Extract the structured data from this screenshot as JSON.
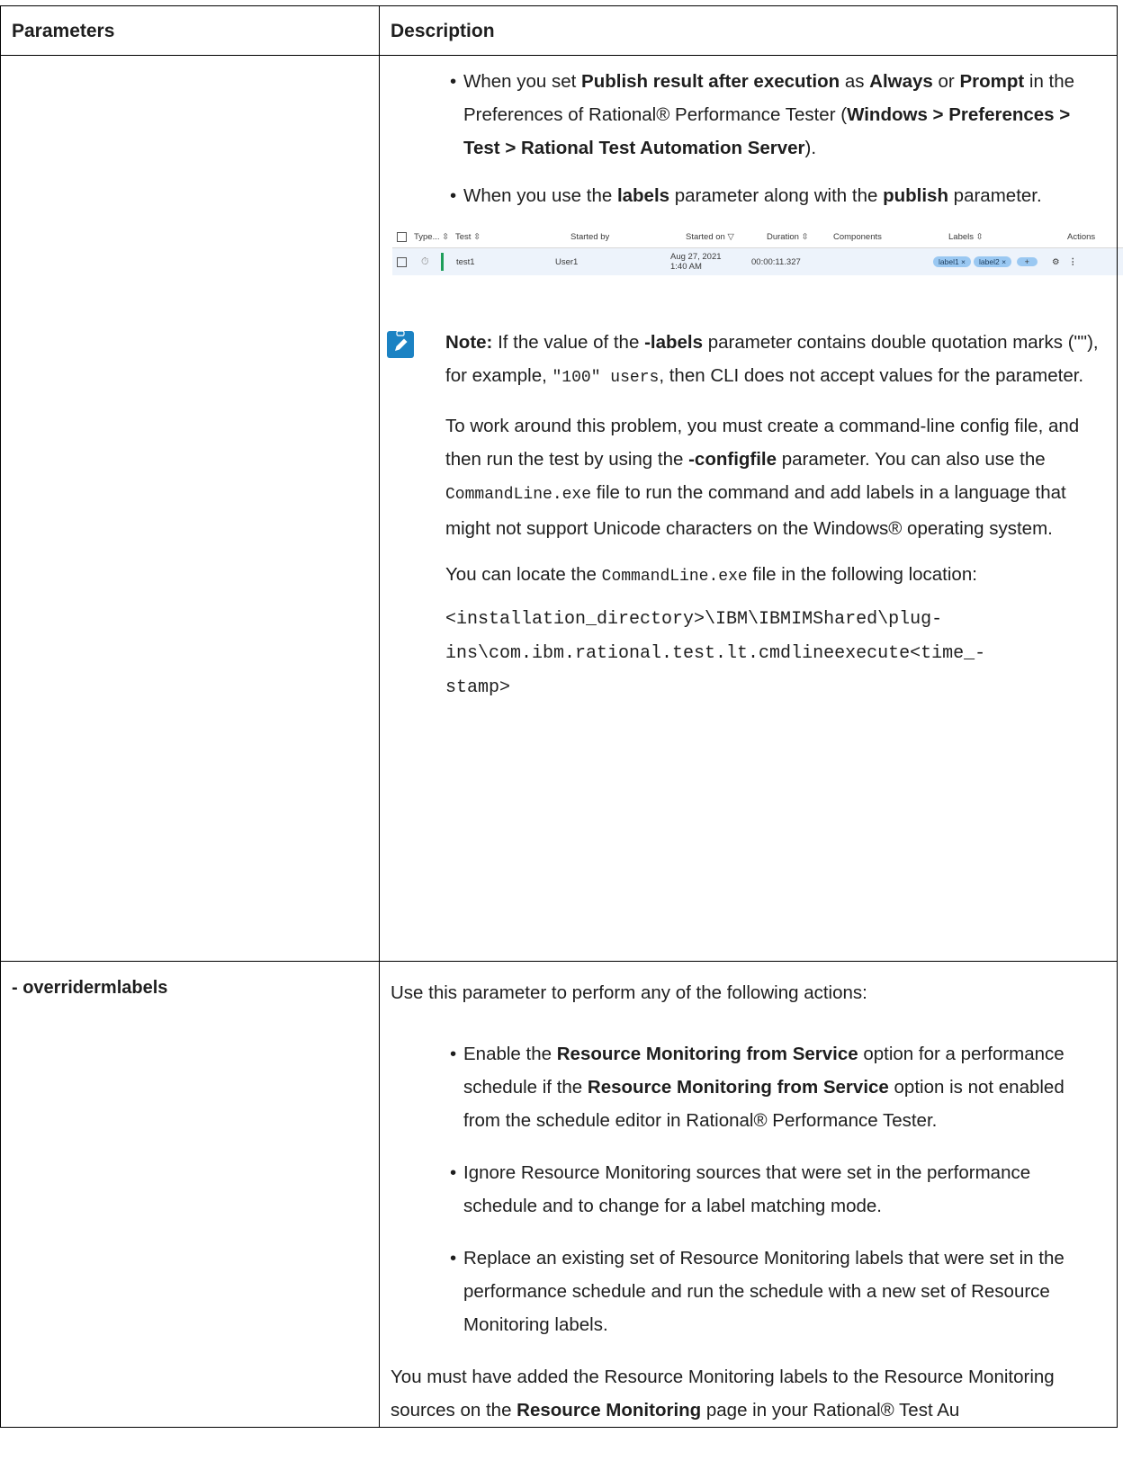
{
  "table": {
    "header": {
      "col1": "Parameters",
      "col2": "Description"
    }
  },
  "row1": {
    "bullets": [
      {
        "parts": [
          {
            "t": "When you set ",
            "b": false
          },
          {
            "t": "Publish result after execution",
            "b": true
          },
          {
            "t": " as ",
            "b": false
          },
          {
            "t": "Always",
            "b": true
          },
          {
            "t": " or ",
            "b": false
          },
          {
            "t": "Prompt",
            "b": true
          },
          {
            "t": " in the Preferences of  Rational® Performance Tester (",
            "b": false
          },
          {
            "t": "Windows > Preferences > Test > Rational Test Automation Server",
            "b": true
          },
          {
            "t": ").",
            "b": false
          }
        ]
      },
      {
        "parts": [
          {
            "t": "When you use the ",
            "b": false
          },
          {
            "t": "labels",
            "b": true
          },
          {
            "t": " parameter along with the ",
            "b": false
          },
          {
            "t": "publish",
            "b": true
          },
          {
            "t": " parameter.",
            "b": false
          }
        ]
      }
    ],
    "screenshot": {
      "headers": [
        "Type...",
        "Test",
        "Started by",
        "Started on",
        "Duration",
        "Components",
        "Labels",
        "Actions"
      ],
      "row": {
        "test": "test1",
        "started_by": "User1",
        "started_on_date": "Aug 27, 2021",
        "started_on_time": "1:40 AM",
        "duration": "00:00:11.327",
        "labels": [
          "label1",
          "label2"
        ],
        "add": "+"
      },
      "colors": {
        "row_bg": "#edf3fb",
        "status_bar": "#1e9e5a",
        "pill": "#9ac8f2"
      }
    },
    "note": {
      "icon": "pencil-note-icon",
      "label": "Note:",
      "p1_parts": [
        {
          "t": " If the value of the ",
          "k": "n"
        },
        {
          "t": "-labels",
          "k": "b"
        },
        {
          "t": " parameter contains double quotation marks (\"\"), for example, ",
          "k": "n"
        },
        {
          "t": "\"100\" users",
          "k": "c"
        },
        {
          "t": ", then CLI does not accept values for the parameter.",
          "k": "n"
        }
      ],
      "p2_parts": [
        {
          "t": "To work around this problem, you must create a command-line config file, and then run the test by using the ",
          "k": "n"
        },
        {
          "t": "-configfile",
          "k": "b"
        },
        {
          "t": " parameter. You can also use the ",
          "k": "n"
        },
        {
          "t": "CommandLine.exe",
          "k": "c"
        },
        {
          "t": " file to run the command and add labels in a language that might not support Unicode characters on the Windows® operating system.",
          "k": "n"
        }
      ],
      "p3_parts": [
        {
          "t": "You can locate the ",
          "k": "n"
        },
        {
          "t": "CommandLine.exe",
          "k": "c"
        },
        {
          "t": " file in the following location:",
          "k": "n"
        }
      ],
      "path_lines": [
        "<installation_directory>\\IBM\\IBMIMShared\\plug-",
        "ins\\com.ibm.rational.test.lt.cmdlineexecute<time_-",
        "stamp>"
      ]
    }
  },
  "row2": {
    "param": "- overridermlabels",
    "intro": "Use this parameter to perform any of the following actions:",
    "bullets": [
      {
        "parts": [
          {
            "t": "Enable the ",
            "b": false
          },
          {
            "t": "Resource Monitoring from Service",
            "b": true
          },
          {
            "t": " option for a performance schedule if the ",
            "b": false
          },
          {
            "t": "Resource Monitoring from Service",
            "b": true
          },
          {
            "t": " option is not enabled from the schedule editor in  Rational® Performance Tester.",
            "b": false
          }
        ]
      },
      {
        "parts": [
          {
            "t": "Ignore Resource Monitoring sources that were set in the performance schedule and to change for a label matching mode.",
            "b": false
          }
        ]
      },
      {
        "parts": [
          {
            "t": "Replace an existing set of Resource Monitoring labels that were set in the performance schedule and run the schedule with a new set of Resource Monitoring labels.",
            "b": false
          }
        ]
      }
    ],
    "tail_parts": [
      {
        "t": "You must have added the Resource Monitoring labels to the Resource Monitoring sources on the ",
        "b": false
      },
      {
        "t": "Resource Monitoring",
        "b": true
      },
      {
        "t": " page in your Rational® Test Au",
        "b": false
      }
    ]
  }
}
